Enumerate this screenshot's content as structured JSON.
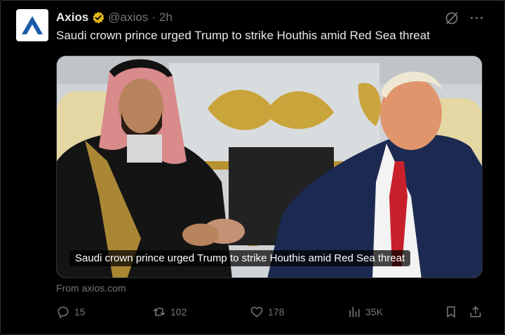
{
  "colors": {
    "background": "#000000",
    "text_primary": "#e7e9ea",
    "text_secondary": "#71767b",
    "verified_badge": "#e2b719",
    "axios_logo": "#1a5aa8"
  },
  "post": {
    "author": {
      "name": "Axios",
      "handle": "@axios",
      "separator": "·",
      "time": "2h",
      "avatar_icon": "axios-logo-icon",
      "badge_icon": "verified-gold-badge-icon"
    },
    "text": "Saudi crown prince urged Trump to strike Houthis amid Red Sea threat",
    "media": {
      "caption": "Saudi crown prince urged Trump to strike Houthis amid Red Sea threat",
      "source": "From axios.com"
    },
    "actions": {
      "replies": "15",
      "reposts": "102",
      "likes": "178",
      "views": "35K"
    }
  }
}
